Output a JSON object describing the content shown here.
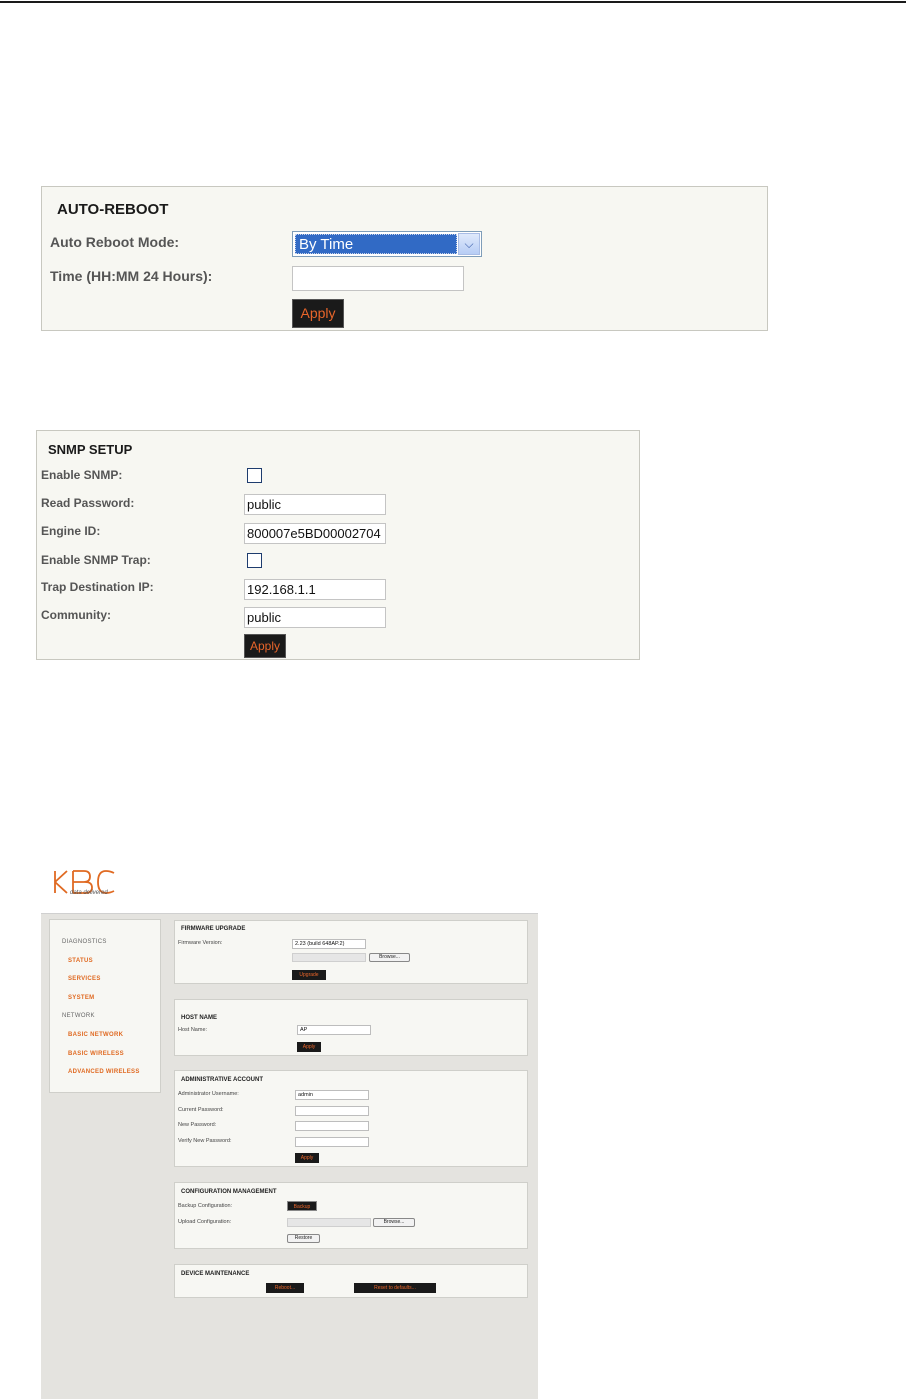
{
  "auto_reboot": {
    "title": "AUTO-REBOOT",
    "mode_label": "Auto Reboot Mode:",
    "mode_value": "By Time",
    "time_label": "Time (HH:MM 24 Hours):",
    "time_value": "",
    "apply_label": "Apply"
  },
  "snmp": {
    "title": "SNMP SETUP",
    "enable_label": "Enable SNMP:",
    "enable_checked": false,
    "read_password_label": "Read Password:",
    "read_password_value": "public",
    "engine_id_label": "Engine ID:",
    "engine_id_value": "800007e5BD00002704",
    "enable_trap_label": "Enable SNMP Trap:",
    "enable_trap_checked": false,
    "trap_ip_label": "Trap Destination IP:",
    "trap_ip_value": "192.168.1.1",
    "community_label": "Community:",
    "community_value": "public",
    "apply_label": "Apply"
  },
  "kbc": {
    "logo_text": "KBC",
    "tagline": "data delivered",
    "brand_color": "#e06a22",
    "nav": {
      "diagnostics": "DIAGNOSTICS",
      "status": "STATUS",
      "services": "SERVICES",
      "system": "SYSTEM",
      "network": "NETWORK",
      "basic_network": "BASIC NETWORK",
      "basic_wireless": "BASIC WIRELESS",
      "advanced_wireless": "ADVANCED WIRELESS"
    },
    "firmware": {
      "title": "FIRMWARE UPGRADE",
      "version_label": "Firmware Version:",
      "version_value": "2.23 (build 648AP.2)",
      "browse_label": "Browse...",
      "upgrade_label": "Upgrade"
    },
    "host": {
      "title": "HOST NAME",
      "name_label": "Host Name:",
      "name_value": "AP",
      "apply_label": "Apply"
    },
    "admin": {
      "title": "ADMINISTRATIVE ACCOUNT",
      "username_label": "Administrator Username:",
      "username_value": "admin",
      "current_label": "Current Password:",
      "new_label": "New Password:",
      "verify_label": "Verify New Password:",
      "apply_label": "Apply"
    },
    "config": {
      "title": "CONFIGURATION MANAGEMENT",
      "backup_label": "Backup Configuration:",
      "backup_button": "Backup",
      "upload_label": "Upload Configuration:",
      "browse_label": "Browse...",
      "restore_label": "Restore"
    },
    "maintenance": {
      "title": "DEVICE MAINTENANCE",
      "reboot_label": "Reboot...",
      "reset_label": "Reset to defaults..."
    }
  }
}
